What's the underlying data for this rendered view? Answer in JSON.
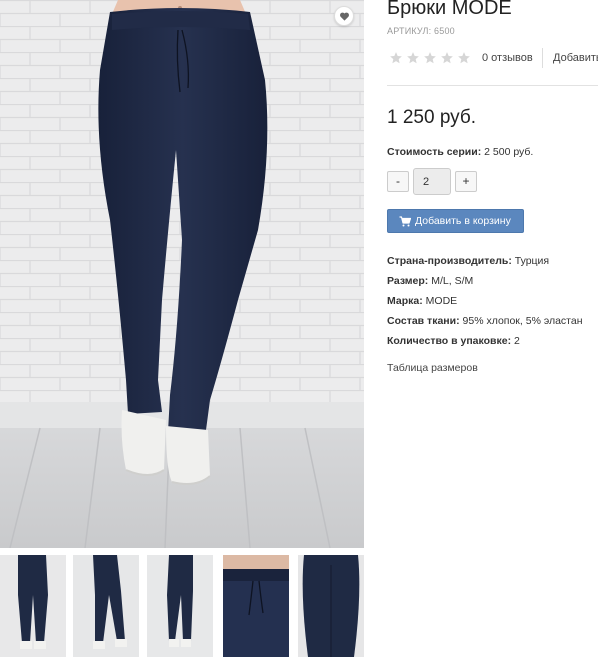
{
  "product": {
    "title": "Брюки MODE",
    "sku": "АРТИКУЛ: 6500",
    "rating": {
      "stars_filled": 0,
      "stars_total": 5,
      "reviews_label": "0 отзывов",
      "add_review_label": "Добавить"
    },
    "price": "1 250 руб.",
    "series": {
      "label": "Стоимость серии:",
      "value": "2 500 руб."
    },
    "quantity": {
      "minus_label": "-",
      "value": "2",
      "plus_label": "+"
    },
    "add_to_cart_label": "Добавить в корзину",
    "properties": [
      {
        "label": "Страна-производитель:",
        "value": "Турция"
      },
      {
        "label": "Размер:",
        "value": "M/L, S/M"
      },
      {
        "label": "Марка:",
        "value": "MODE"
      },
      {
        "label": "Состав ткани:",
        "value": "95% хлопок, 5% эластан"
      },
      {
        "label": "Количество в упаковке:",
        "value": "2"
      }
    ],
    "size_table_link": "Таблица размеров"
  },
  "gallery": {
    "thumbnail_count": 5
  },
  "colors": {
    "accent_button": "#5b87be",
    "pants": "#1f2a44",
    "star_empty": "#d6d6d6"
  }
}
